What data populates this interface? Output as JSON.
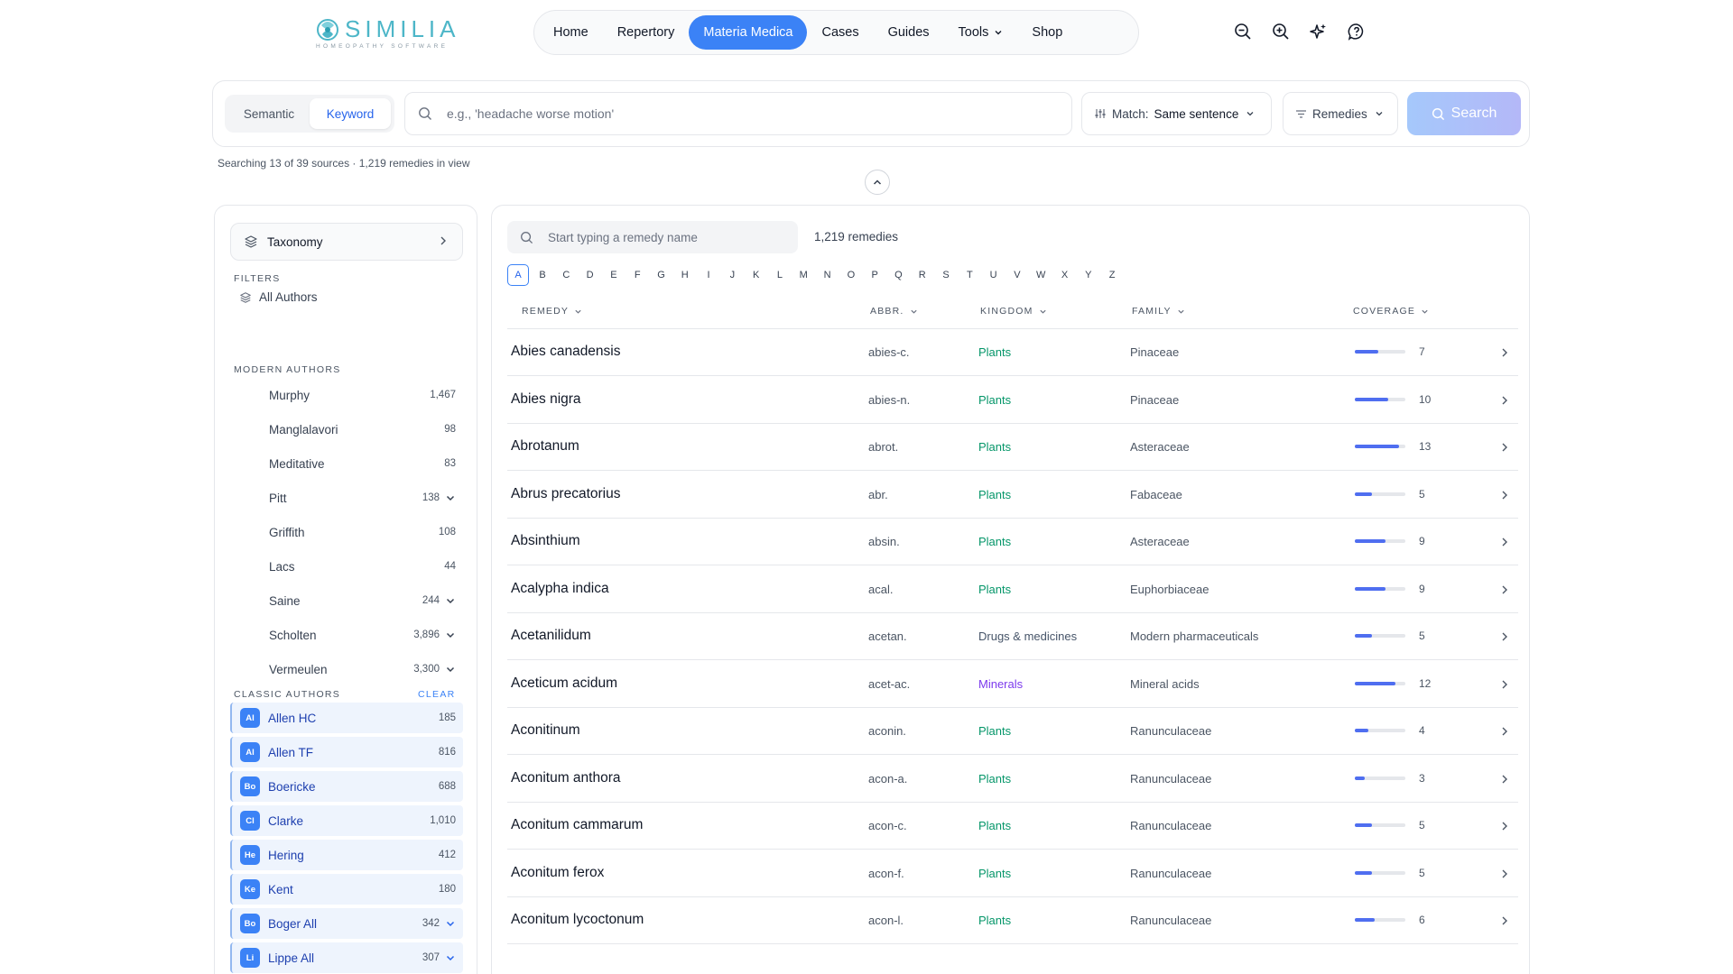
{
  "brand": {
    "name": "SIMILIA",
    "tagline": "HOMEOPATHY SOFTWARE",
    "color": "#4db6c8"
  },
  "nav": {
    "items": [
      {
        "label": "Home",
        "active": false
      },
      {
        "label": "Repertory",
        "active": false
      },
      {
        "label": "Materia Medica",
        "active": true
      },
      {
        "label": "Cases",
        "active": false
      },
      {
        "label": "Guides",
        "active": false
      },
      {
        "label": "Tools",
        "active": false,
        "dropdown": true
      },
      {
        "label": "Shop",
        "active": false
      }
    ],
    "icons": [
      "zoom-out-icon",
      "zoom-in-icon",
      "sparkles-icon",
      "help-icon"
    ]
  },
  "search": {
    "modes": [
      "Semantic",
      "Keyword"
    ],
    "active_mode": "Keyword",
    "placeholder": "e.g., 'headache worse motion'",
    "value": "",
    "match_label": "Match:",
    "match_value": "Same sentence",
    "remedies_label": "Remedies",
    "button_label": "Search",
    "sources_text": "Searching 13 of 39 sources · 1,219 remedies in view"
  },
  "sidebar": {
    "taxonomy_label": "Taxonomy",
    "filters_heading": "FILTERS",
    "all_authors_label": "All Authors",
    "modern_heading": "MODERN AUTHORS",
    "modern_authors": [
      {
        "name": "Murphy",
        "count": "1,467",
        "expandable": false
      },
      {
        "name": "Manglalavori",
        "count": "98",
        "expandable": false
      },
      {
        "name": "Meditative",
        "count": "83",
        "expandable": false
      },
      {
        "name": "Pitt",
        "count": "138",
        "expandable": true
      },
      {
        "name": "Griffith",
        "count": "108",
        "expandable": false
      },
      {
        "name": "Lacs",
        "count": "44",
        "expandable": false
      },
      {
        "name": "Saine",
        "count": "244",
        "expandable": true
      },
      {
        "name": "Scholten",
        "count": "3,896",
        "expandable": true
      },
      {
        "name": "Vermeulen",
        "count": "3,300",
        "expandable": true
      }
    ],
    "classic_heading": "CLASSIC AUTHORS",
    "clear_label": "CLEAR",
    "classic_authors": [
      {
        "badge": "Al",
        "name": "Allen HC",
        "count": "185",
        "expandable": false
      },
      {
        "badge": "Al",
        "name": "Allen TF",
        "count": "816",
        "expandable": false
      },
      {
        "badge": "Bo",
        "name": "Boericke",
        "count": "688",
        "expandable": false
      },
      {
        "badge": "Cl",
        "name": "Clarke",
        "count": "1,010",
        "expandable": false
      },
      {
        "badge": "He",
        "name": "Hering",
        "count": "412",
        "expandable": false
      },
      {
        "badge": "Ke",
        "name": "Kent",
        "count": "180",
        "expandable": false
      },
      {
        "badge": "Bo",
        "name": "Boger All",
        "count": "342",
        "expandable": true
      },
      {
        "badge": "Li",
        "name": "Lippe All",
        "count": "307",
        "expandable": true
      }
    ]
  },
  "main": {
    "name_search_placeholder": "Start typing a remedy name",
    "count_label": "1,219 remedies",
    "alphabet": [
      "A",
      "B",
      "C",
      "D",
      "E",
      "F",
      "G",
      "H",
      "I",
      "J",
      "K",
      "L",
      "M",
      "N",
      "O",
      "P",
      "Q",
      "R",
      "S",
      "T",
      "U",
      "V",
      "W",
      "X",
      "Y",
      "Z"
    ],
    "active_letter": "A",
    "columns": [
      "REMEDY",
      "ABBR.",
      "KINGDOM",
      "FAMILY",
      "COVERAGE"
    ],
    "kingdom_colors": {
      "Plants": "#059669",
      "Drugs & medicines": "#475569",
      "Minerals": "#7c3aed"
    },
    "coverage_max": 15,
    "rows": [
      {
        "name": "Abies canadensis",
        "abbr": "abies-c.",
        "kingdom": "Plants",
        "family": "Pinaceae",
        "coverage": "7"
      },
      {
        "name": "Abies nigra",
        "abbr": "abies-n.",
        "kingdom": "Plants",
        "family": "Pinaceae",
        "coverage": "10"
      },
      {
        "name": "Abrotanum",
        "abbr": "abrot.",
        "kingdom": "Plants",
        "family": "Asteraceae",
        "coverage": "13"
      },
      {
        "name": "Abrus precatorius",
        "abbr": "abr.",
        "kingdom": "Plants",
        "family": "Fabaceae",
        "coverage": "5"
      },
      {
        "name": "Absinthium",
        "abbr": "absin.",
        "kingdom": "Plants",
        "family": "Asteraceae",
        "coverage": "9"
      },
      {
        "name": "Acalypha indica",
        "abbr": "acal.",
        "kingdom": "Plants",
        "family": "Euphorbiaceae",
        "coverage": "9"
      },
      {
        "name": "Acetanilidum",
        "abbr": "acetan.",
        "kingdom": "Drugs & medicines",
        "family": "Modern pharmaceuticals",
        "coverage": "5"
      },
      {
        "name": "Aceticum acidum",
        "abbr": "acet-ac.",
        "kingdom": "Minerals",
        "family": "Mineral acids",
        "coverage": "12"
      },
      {
        "name": "Aconitinum",
        "abbr": "aconin.",
        "kingdom": "Plants",
        "family": "Ranunculaceae",
        "coverage": "4"
      },
      {
        "name": "Aconitum anthora",
        "abbr": "acon-a.",
        "kingdom": "Plants",
        "family": "Ranunculaceae",
        "coverage": "3"
      },
      {
        "name": "Aconitum cammarum",
        "abbr": "acon-c.",
        "kingdom": "Plants",
        "family": "Ranunculaceae",
        "coverage": "5"
      },
      {
        "name": "Aconitum ferox",
        "abbr": "acon-f.",
        "kingdom": "Plants",
        "family": "Ranunculaceae",
        "coverage": "5"
      },
      {
        "name": "Aconitum lycoctonum",
        "abbr": "acon-l.",
        "kingdom": "Plants",
        "family": "Ranunculaceae",
        "coverage": "6"
      }
    ]
  }
}
